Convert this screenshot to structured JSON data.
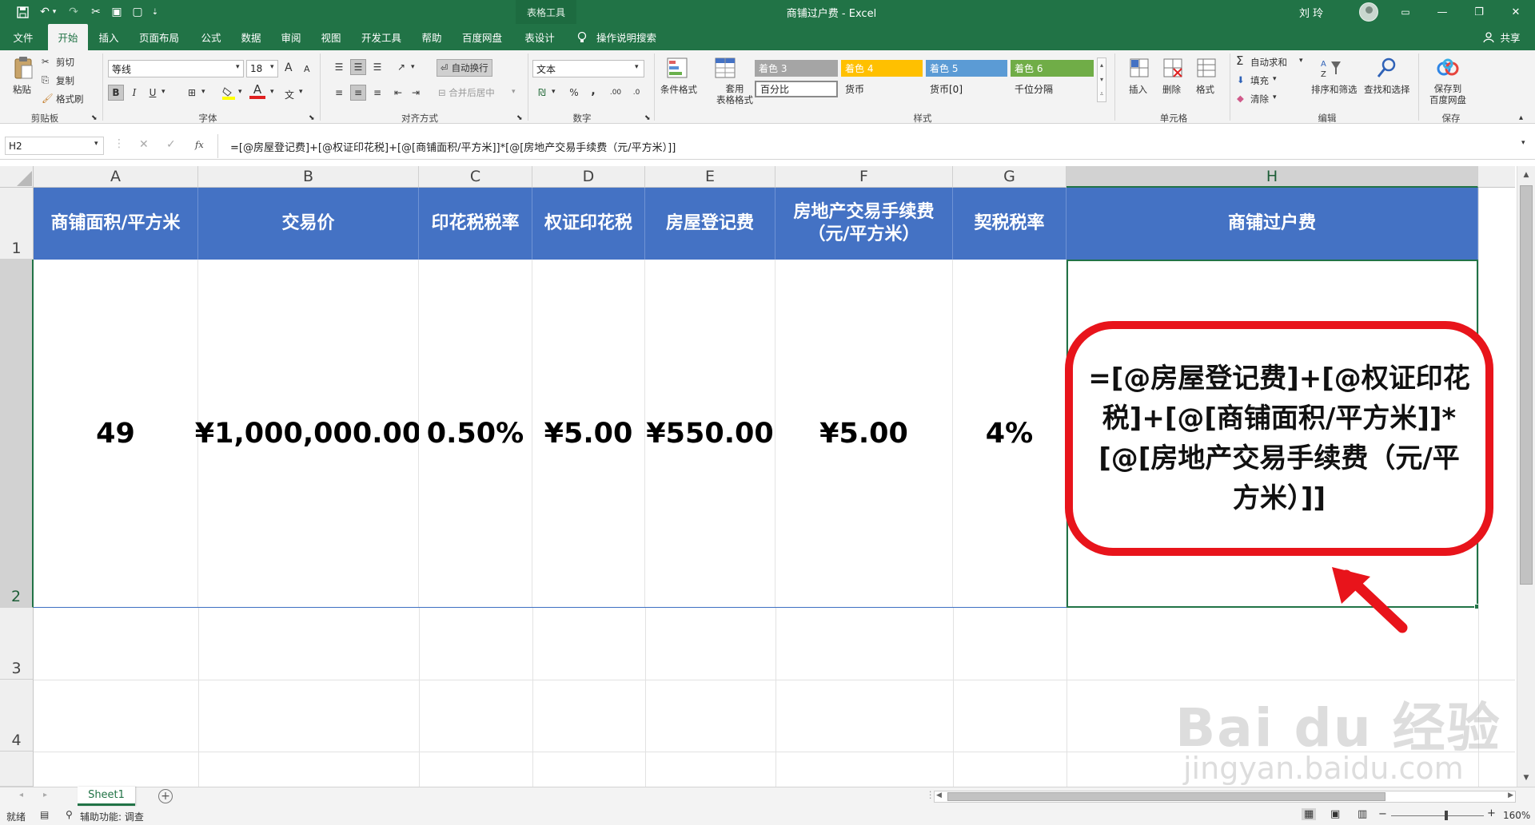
{
  "titlebar": {
    "context_tab": "表格工具",
    "window_title": "商铺过户费 - Excel",
    "user_name": "刘 玲",
    "min": "—",
    "restore": "❐",
    "close": "✕"
  },
  "tabs": [
    "文件",
    "开始",
    "插入",
    "页面布局",
    "公式",
    "数据",
    "审阅",
    "视图",
    "开发工具",
    "帮助",
    "百度网盘",
    "表设计"
  ],
  "tell_me": "操作说明搜索",
  "share": "共享",
  "ribbon": {
    "clipboard": {
      "paste": "粘贴",
      "cut": "剪切",
      "copy": "复制",
      "format_painter": "格式刷",
      "label": "剪贴板"
    },
    "font": {
      "name": "等线",
      "size": "18",
      "bold": "B",
      "italic": "I",
      "underline": "U",
      "label": "字体",
      "grow": "A",
      "shrink": "A",
      "color_letter": "A"
    },
    "alignment": {
      "wrap": "自动换行",
      "merge": "合并后居中",
      "label": "对齐方式"
    },
    "number": {
      "format": "文本",
      "percent": "%",
      "comma": ",",
      "label": "数字"
    },
    "styles": {
      "cond": "条件格式",
      "table": "套用\n表格格式",
      "accent3": "着色 3",
      "accent4": "着色 4",
      "accent5": "着色 5",
      "accent6": "着色 6",
      "percent": "百分比",
      "currency": "货币",
      "currency0": "货币[0]",
      "thousands": "千位分隔",
      "label": "样式"
    },
    "cells": {
      "insert": "插入",
      "delete": "删除",
      "format": "格式",
      "label": "单元格"
    },
    "editing": {
      "autosum": "自动求和",
      "fill": "填充",
      "clear": "清除",
      "sort": "排序和筛选",
      "find": "查找和选择",
      "label": "编辑"
    },
    "save": {
      "save_to": "保存到\n百度网盘",
      "label": "保存"
    }
  },
  "formula_bar": {
    "name_box": "H2",
    "fx": "fx",
    "formula": "=[@房屋登记费]+[@权证印花税]+[@[商铺面积/平方米]]*[@[房地产交易手续费（元/平方米）]]"
  },
  "columns": [
    "A",
    "B",
    "C",
    "D",
    "E",
    "F",
    "G",
    "H"
  ],
  "rows": [
    "1",
    "2",
    "3",
    "4"
  ],
  "header_row": [
    "商铺面积/平方米",
    "交易价",
    "印花税税率",
    "权证印花税",
    "房屋登记费",
    "房地产交易手续费\n（元/平方米）",
    "契税税率",
    "商铺过户费"
  ],
  "data_row": [
    "49",
    "¥1,000,000.00",
    "0.50%",
    "¥5.00",
    "¥550.00",
    "¥5.00",
    "4%",
    ""
  ],
  "callout_text": "=[@房屋登记费]+[@权证印花税]+[@[商铺面积/平方米]]*[@[房地产交易手续费（元/平方米）]]",
  "sheet_tab": "Sheet1",
  "status": {
    "ready": "就绪",
    "accessibility": "辅助功能: 调查",
    "zoom": "160%"
  },
  "colors": {
    "excel_green": "#217346",
    "header_fill": "#4472c4",
    "callout_red": "#e8141b"
  },
  "watermark": {
    "brand": "Bai du 经验",
    "url": "jingyan.baidu.com"
  }
}
